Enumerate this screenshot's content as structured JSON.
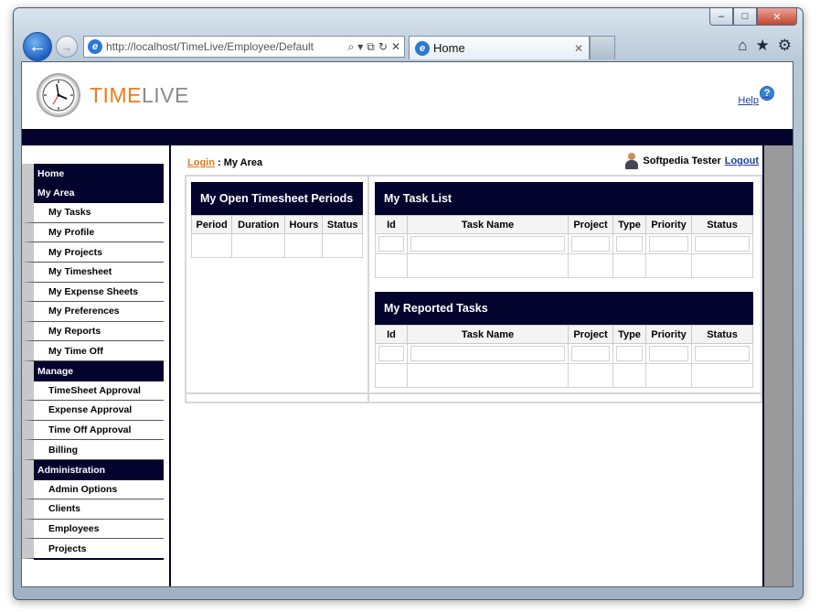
{
  "browser": {
    "address": "http://localhost/TimeLive/Employee/Default",
    "tab_title": "Home",
    "tab_close": "✕",
    "window_controls": {
      "minimize": "–",
      "maximize": "□",
      "close": "✕"
    },
    "tools": [
      "⌂",
      "★",
      "⚙"
    ],
    "nav": {
      "back": "←",
      "forward": "→"
    },
    "addr_tools": [
      "⌕",
      "▾",
      "⧉",
      "↻",
      "✕"
    ],
    "site_icon": "e"
  },
  "header": {
    "logo_time": "TIME",
    "logo_live": "LIVE",
    "help_label": "Help",
    "help_icon": "?"
  },
  "sidebar": {
    "items": [
      {
        "label": "Home",
        "type": "section"
      },
      {
        "label": "My Area",
        "type": "section"
      },
      {
        "label": "My Tasks",
        "type": "link"
      },
      {
        "label": "My Profile",
        "type": "link"
      },
      {
        "label": "My Projects",
        "type": "link"
      },
      {
        "label": "My Timesheet",
        "type": "link"
      },
      {
        "label": "My Expense Sheets",
        "type": "link"
      },
      {
        "label": "My Preferences",
        "type": "link"
      },
      {
        "label": "My Reports",
        "type": "link"
      },
      {
        "label": "My Time Off",
        "type": "link"
      },
      {
        "label": "Manage",
        "type": "section"
      },
      {
        "label": "TimeSheet Approval",
        "type": "link"
      },
      {
        "label": "Expense Approval",
        "type": "link"
      },
      {
        "label": "Time Off Approval",
        "type": "link"
      },
      {
        "label": "Billing",
        "type": "link"
      },
      {
        "label": "Administration",
        "type": "section"
      },
      {
        "label": "Admin Options",
        "type": "link"
      },
      {
        "label": "Clients",
        "type": "link"
      },
      {
        "label": "Employees",
        "type": "link"
      },
      {
        "label": "Projects",
        "type": "link"
      }
    ]
  },
  "breadcrumb": {
    "login": "Login",
    "separator": " : ",
    "current": "My Area"
  },
  "user": {
    "name": "Softpedia Tester",
    "logout": "Logout"
  },
  "timesheet_panel": {
    "title": "My Open Timesheet Periods",
    "columns": [
      "Period",
      "Duration",
      "Hours",
      "Status"
    ]
  },
  "task_list_panel": {
    "title": "My Task List",
    "columns": [
      "Id",
      "Task Name",
      "Project",
      "Type",
      "Priority",
      "Status"
    ]
  },
  "reported_tasks_panel": {
    "title": "My Reported Tasks",
    "columns": [
      "Id",
      "Task Name",
      "Project",
      "Type",
      "Priority",
      "Status"
    ]
  },
  "colors": {
    "navy": "#03032e",
    "orange": "#f07c16",
    "link_blue": "#1f3fa0"
  }
}
